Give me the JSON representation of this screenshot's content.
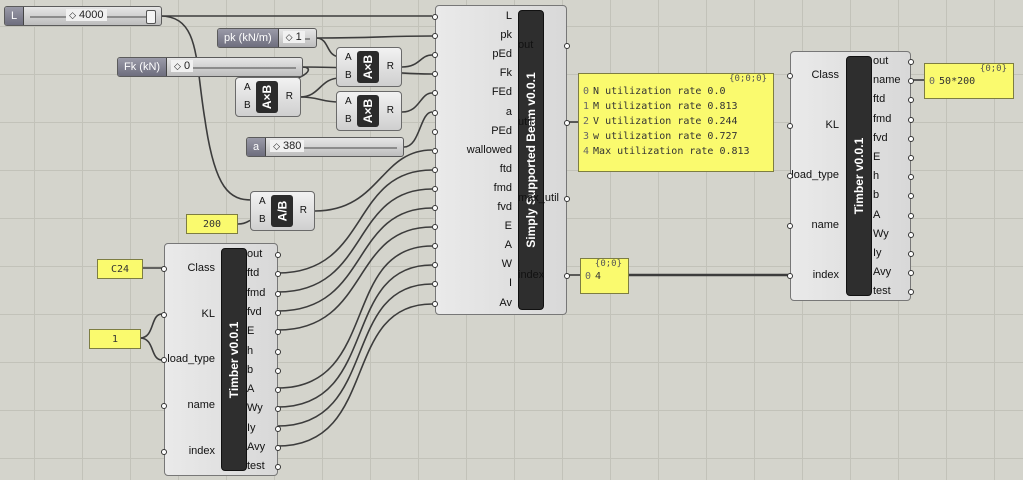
{
  "sliders": {
    "L": {
      "label": "L",
      "value": "4000"
    },
    "pk": {
      "label": "pk (kN/m)",
      "value": "1"
    },
    "Fk": {
      "label": "Fk (kN)",
      "value": "0"
    },
    "a": {
      "label": "a",
      "value": "380"
    }
  },
  "ops": {
    "mul1": {
      "a": "A",
      "b": "B",
      "out": "R",
      "symbol": "A×B"
    },
    "mul2": {
      "a": "A",
      "b": "B",
      "out": "R",
      "symbol": "A×B"
    },
    "mul3": {
      "a": "A",
      "b": "B",
      "out": "R",
      "symbol": "A×B"
    },
    "div": {
      "a": "A",
      "b": "B",
      "out": "R",
      "symbol": "A/B"
    }
  },
  "panels": {
    "p200": "200",
    "pC24": "C24",
    "p1": "1",
    "util": {
      "header": "{0;0;0}",
      "rows": [
        {
          "i": "0",
          "text": "N utilization rate 0.0"
        },
        {
          "i": "1",
          "text": "M utilization rate 0.813"
        },
        {
          "i": "2",
          "text": "V utilization rate 0.244"
        },
        {
          "i": "3",
          "text": "w utilization rate 0.727"
        },
        {
          "i": "4",
          "text": "Max utilization rate 0.813"
        }
      ]
    },
    "index": {
      "header": "{0;0}",
      "row_i": "0",
      "row_text": "4"
    },
    "name": {
      "header": "{0;0}",
      "row_i": "0",
      "row_text": "50*200"
    }
  },
  "beam": {
    "title": "Simply Supported Beam v0.0.1",
    "inputs": [
      "L",
      "pk",
      "pEd",
      "Fk",
      "FEd",
      "a",
      "PEd",
      "wallowed",
      "ftd",
      "fmd",
      "fvd",
      "E",
      "A",
      "W",
      "I",
      "Av"
    ],
    "outputs": [
      "out",
      "util",
      "max_util",
      "index"
    ]
  },
  "timber_left": {
    "title": "Timber v0.0.1",
    "inputs": [
      "Class",
      "KL",
      "load_type",
      "name",
      "index"
    ],
    "outputs": [
      "out",
      "ftd",
      "fmd",
      "fvd",
      "E",
      "h",
      "b",
      "A",
      "Wy",
      "Iy",
      "Avy",
      "test"
    ]
  },
  "timber_right": {
    "title": "Timber v0.0.1",
    "inputs": [
      "Class",
      "KL",
      "load_type",
      "name",
      "index"
    ],
    "outputs": [
      "out",
      "name",
      "ftd",
      "fmd",
      "fvd",
      "E",
      "h",
      "b",
      "A",
      "Wy",
      "Iy",
      "Avy",
      "test"
    ]
  }
}
